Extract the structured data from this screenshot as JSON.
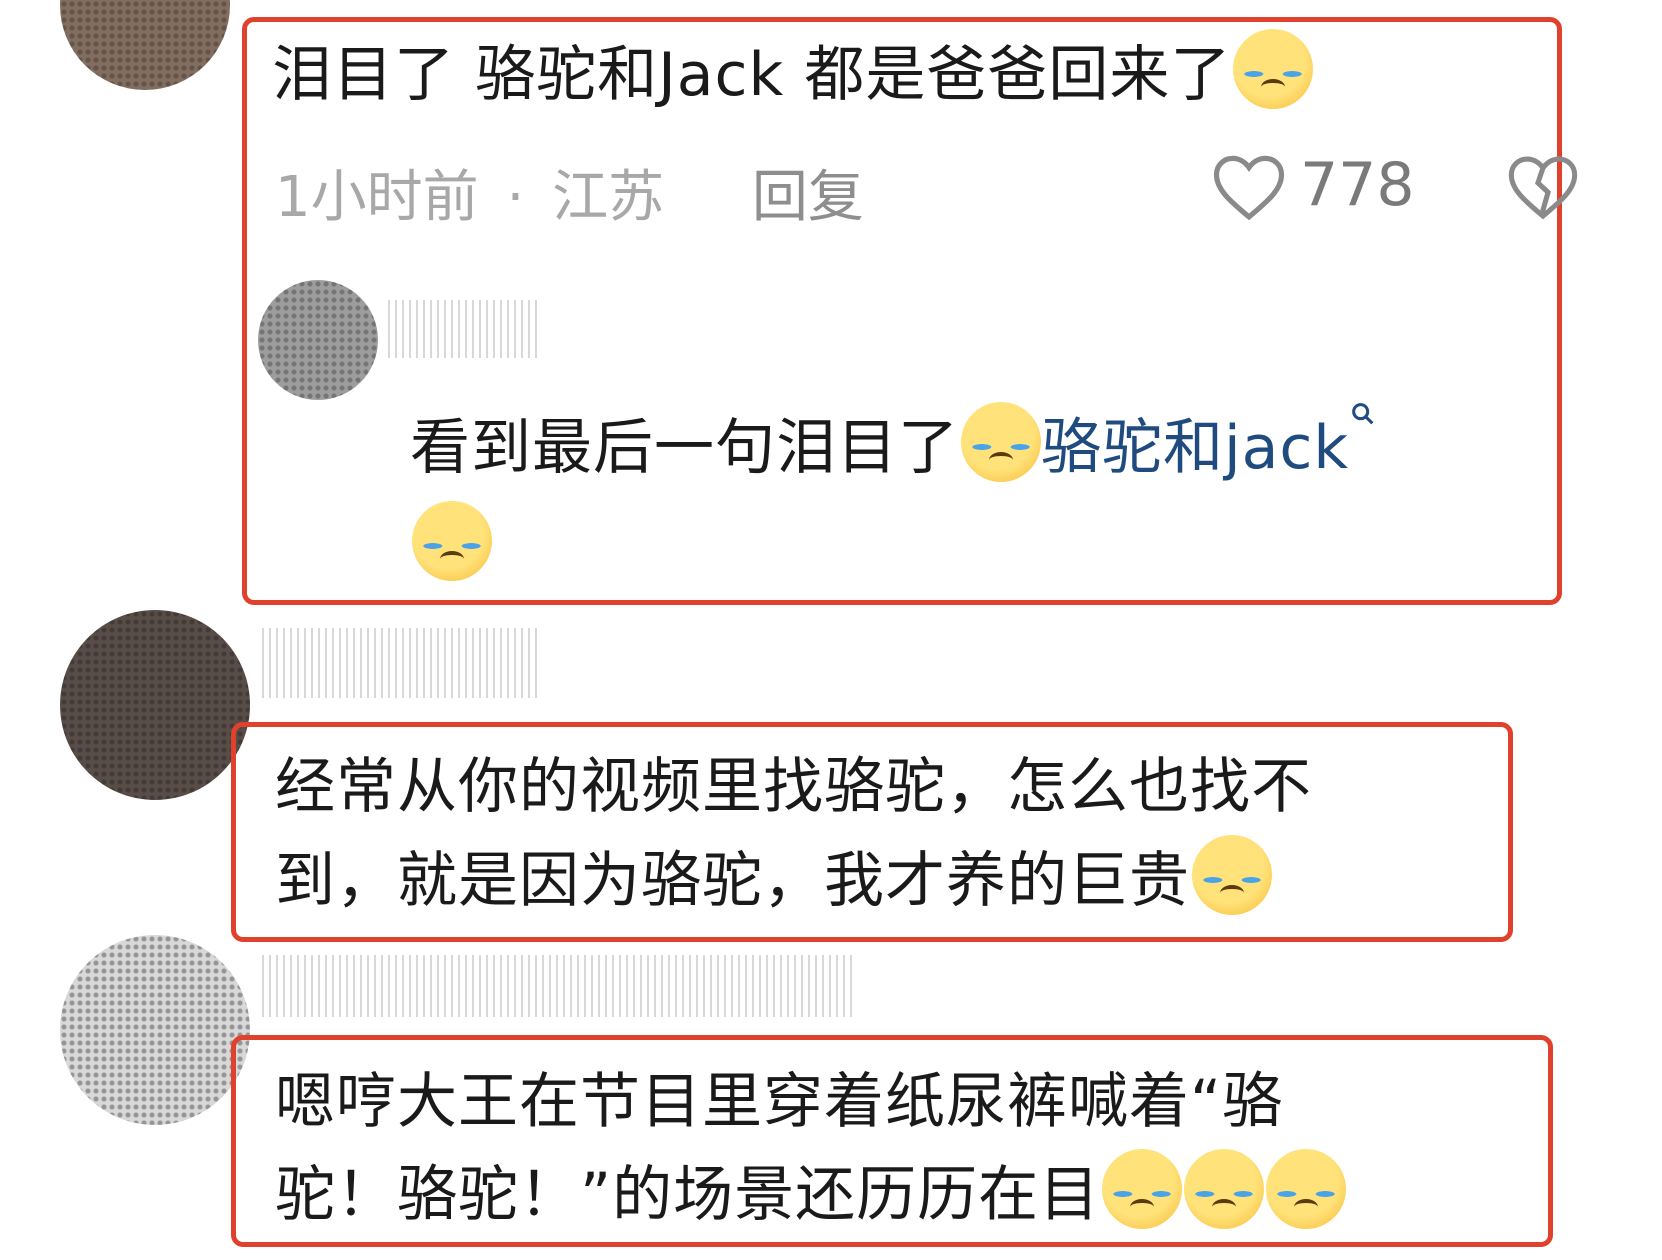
{
  "comments": [
    {
      "text": "泪目了 骆驼和Jack 都是爸爸回来了",
      "emoji_count": 1,
      "time": "1小时前",
      "separator": "·",
      "location": "江苏",
      "reply_label": "回复",
      "like_count": "778",
      "reply": {
        "text": "看到最后一句泪目了",
        "link_text": "骆驼和jack",
        "emoji": "loudly-crying-face"
      }
    },
    {
      "text_line1": "经常从你的视频里找骆驼，怎么也找不",
      "text_line2": "到，就是因为骆驼，我才养的巨贵"
    },
    {
      "text_line1": "嗯哼大王在节目里穿着纸尿裤喊着“骆",
      "text_line2": "驼！骆驼！”的场景还历历在目"
    }
  ],
  "colors": {
    "highlight_border": "#e0412c",
    "link": "#1f4b7e",
    "meta_text": "#a8a8a8"
  },
  "icons": [
    "heart-outline-icon",
    "dislike-heart-icon",
    "search-icon",
    "loudly-crying-face-emoji"
  ]
}
